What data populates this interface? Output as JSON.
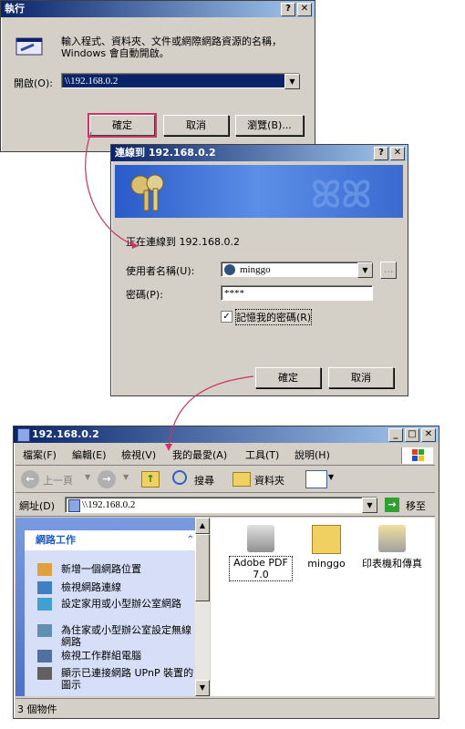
{
  "run": {
    "title": "執行",
    "help_btn": "?",
    "close_btn": "✕",
    "description": "輸入程式、資料夾、文件或網際網路資源的名稱，Windows 會自動開啟。",
    "open_label": "開啟(O):",
    "open_value": "\\\\192.168.0.2",
    "ok": "確定",
    "cancel": "取消",
    "browse": "瀏覽(B)..."
  },
  "connect": {
    "title": "連線到 192.168.0.2",
    "help_btn": "?",
    "close_btn": "✕",
    "connecting_text": "正在連線到 192.168.0.2",
    "username_label": "使用者名稱(U):",
    "username_value": "minggo",
    "password_label": "密碼(P):",
    "password_value": "****",
    "remember_label": "記憶我的密碼(R)",
    "ok": "確定",
    "cancel": "取消",
    "browse_btn": "..."
  },
  "explorer": {
    "title": "192.168.0.2",
    "menu": [
      "檔案(F)",
      "編輯(E)",
      "檢視(V)",
      "我的最愛(A)",
      "工具(T)",
      "說明(H)"
    ],
    "toolbar": {
      "back": "上一頁",
      "search": "搜尋",
      "folders": "資料夾"
    },
    "address_label": "網址(D)",
    "address_value": "\\\\192.168.0.2",
    "go": "移至",
    "tasks_header": "網路工作",
    "tasks": [
      "新增一個網路位置",
      "檢視網路連線",
      "設定家用或小型辦公室網路",
      "為住家或小型辦公室設定無線網路",
      "檢視工作群組電腦",
      "顯示已連接網路 UPnP 裝置的圖示"
    ],
    "files": [
      "Adobe PDF 7.0",
      "minggo",
      "印表機和傳真"
    ],
    "status": "3 個物件"
  },
  "colors": {
    "accent": "#cc3366",
    "title_start": "#0a246a",
    "title_end": "#a6caf0",
    "face": "#d4d0c8"
  }
}
